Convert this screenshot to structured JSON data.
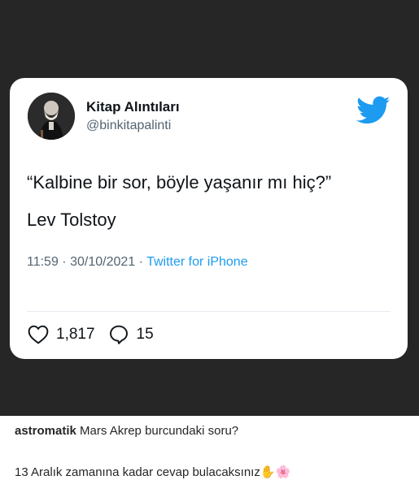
{
  "tweet": {
    "display_name": "Kitap Alıntıları",
    "handle": "@binkitapalinti",
    "text_line_1": "“Kalbine bir sor, böyle yaşanır mı hiç?”",
    "text_line_2": "Lev Tolstoy",
    "time": "11:59",
    "date": "30/10/2021",
    "separator": " · ",
    "source": "Twitter for iPhone",
    "likes": "1,817",
    "replies": "15",
    "icons": {
      "bird": "twitter-bird-icon",
      "heart": "heart-icon",
      "reply": "reply-icon"
    },
    "colors": {
      "brand_blue": "#1d9bf0",
      "text": "#0f1419",
      "muted": "#536471"
    }
  },
  "comments": {
    "first": {
      "username": "astromatik",
      "text": "Mars Akrep burcundaki soru?"
    },
    "second": {
      "text": "13 Aralık zamanına kadar cevap bulacaksınız",
      "emoji_1": "✋",
      "emoji_2": "🌸"
    }
  },
  "colors": {
    "background_dark": "#262626"
  }
}
